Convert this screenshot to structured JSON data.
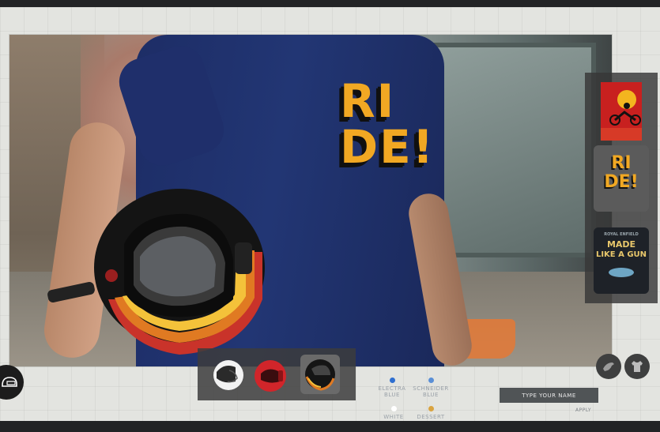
{
  "design_panel": {
    "designs": [
      {
        "name": "rider-sunset-design",
        "selected": false
      },
      {
        "name": "ride-design",
        "text_line1": "RI",
        "text_line2": "DE!",
        "selected": true
      },
      {
        "name": "made-like-a-gun-design",
        "text_top": "ROYAL ENFIELD",
        "text_line1": "MADE",
        "text_line2": "LIKE A GUN",
        "selected": false
      }
    ]
  },
  "shirt_print": {
    "line1": "RI",
    "line2": "DE!"
  },
  "helmet_picker": {
    "helmets": [
      {
        "name": "white-helmet",
        "selected": false
      },
      {
        "name": "red-helmet",
        "selected": false
      },
      {
        "name": "black-stripe-helmet",
        "selected": true
      }
    ]
  },
  "colors": [
    {
      "line1": "ELECTRA",
      "line2": "BLUE",
      "hex": "#2f6fd0"
    },
    {
      "line1": "SCHNEIDER",
      "line2": "BLUE",
      "hex": "#5a8fd6"
    },
    {
      "line1": "WHITE",
      "line2": "",
      "hex": "#ffffff"
    },
    {
      "line1": "DESSERT",
      "line2": "",
      "hex": "#d9a441"
    }
  ],
  "name_field": {
    "placeholder": "TYPE YOUR NAME",
    "apply_label": "APPLY"
  },
  "accent": {
    "gold": "#f1a823",
    "panel": "#373737"
  }
}
